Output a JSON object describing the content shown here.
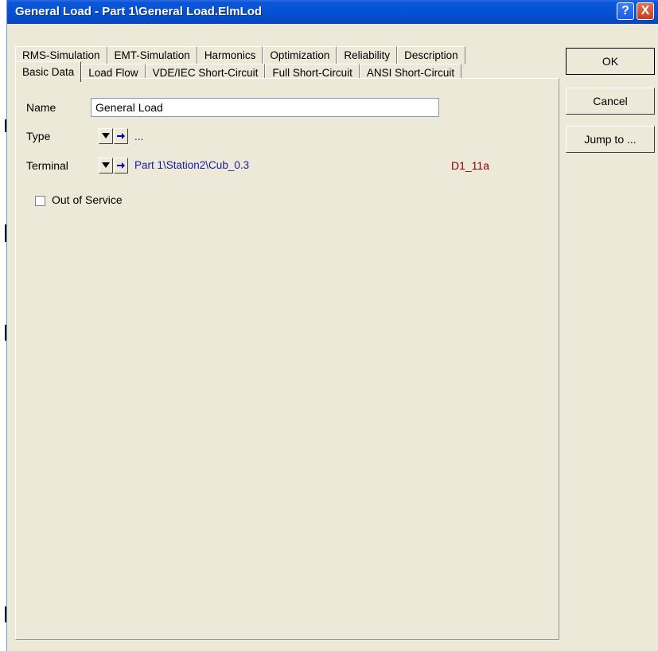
{
  "window": {
    "title": "General Load - Part 1\\General Load.ElmLod",
    "help_label": "?",
    "close_label": "X"
  },
  "tabs": {
    "row1": [
      "RMS-Simulation",
      "EMT-Simulation",
      "Harmonics",
      "Optimization",
      "Reliability",
      "Description"
    ],
    "row2": [
      "Basic Data",
      "Load Flow",
      "VDE/IEC Short-Circuit",
      "Full Short-Circuit",
      "ANSI Short-Circuit"
    ],
    "active": "Basic Data"
  },
  "form": {
    "name_label": "Name",
    "name_value": "General Load",
    "type_label": "Type",
    "type_value": "...",
    "terminal_label": "Terminal",
    "terminal_value": "Part 1\\Station2\\Cub_0.3",
    "terminal_code": "D1_11a",
    "out_of_service_label": "Out of Service",
    "out_of_service_checked": false
  },
  "buttons": {
    "ok": "OK",
    "cancel": "Cancel",
    "jump_to": "Jump to ..."
  },
  "icons": {
    "dropdown": "triangle-down-icon",
    "jump": "arrow-right-icon"
  }
}
